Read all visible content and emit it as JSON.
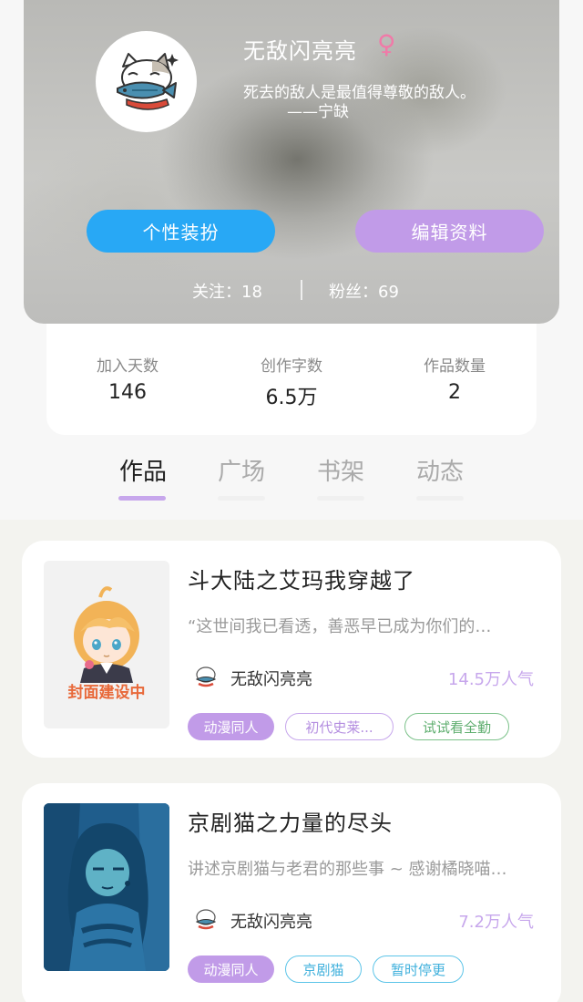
{
  "profile": {
    "username": "无敌闪亮亮",
    "gender_symbol": "♀",
    "motto": "死去的敌人是最值得尊敬的敌人。",
    "motto_author": "——宁缺",
    "dress_button": "个性装扮",
    "edit_button": "编辑资料",
    "following": "关注：18",
    "fans": "粉丝：69"
  },
  "stats": [
    {
      "label": "加入天数",
      "value": "146"
    },
    {
      "label": "创作字数",
      "value": "6.5万"
    },
    {
      "label": "作品数量",
      "value": "2"
    }
  ],
  "tabs": [
    "作品",
    "广场",
    "书架",
    "动态"
  ],
  "active_tab": "作品",
  "books": [
    {
      "title": "斗大陆之艾玛我穿越了",
      "description": "“这世间我已看透，善恶早已成为你们的…",
      "author": "无敌闪亮亮",
      "popularity": "14.5万人气",
      "cover_text": "封面建设中",
      "tags": [
        "动漫同人",
        "初代史莱...",
        "试试看全勤"
      ]
    },
    {
      "title": "京剧猫之力量的尽头",
      "description": "讲述京剧猫与老君的那些事 ~ 感谢橘晓喵…",
      "author": "无敌闪亮亮",
      "popularity": "7.2万人气",
      "tags": [
        "动漫同人",
        "京剧猫",
        "暂时停更"
      ]
    }
  ],
  "colors": {
    "dress_button": "#28a8f5",
    "edit_button": "#c19be8",
    "accent_purple": "#c7a7ec",
    "tag_green": "#7cc28a",
    "tag_blue": "#5cc4e8",
    "female_pink": "#f07aa8"
  },
  "icons": {
    "avatar": "cat-with-fish-icon",
    "cover_1": "anime-girl-cover",
    "cover_2": "blue-figure-cover"
  }
}
